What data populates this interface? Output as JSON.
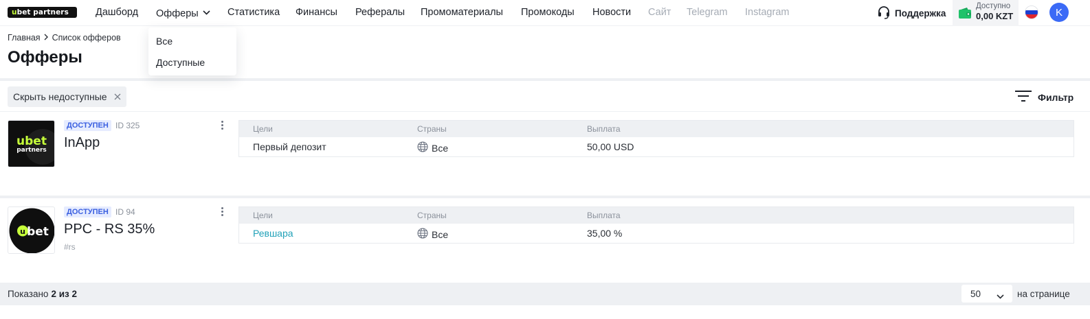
{
  "brand": {
    "logo_u": "u",
    "logo_rest": "bet partners"
  },
  "nav": {
    "items": [
      "Дашборд",
      "Офферы",
      "Статистика",
      "Финансы",
      "Рефералы",
      "Промоматериалы",
      "Промокоды",
      "Новости",
      "Сайт",
      "Telegram",
      "Instagram"
    ],
    "support_label": "Поддержка"
  },
  "wallet": {
    "label": "Доступно",
    "amount": "0,00 KZT"
  },
  "user": {
    "avatar_initial": "K"
  },
  "offers_menu": {
    "items": [
      "Все",
      "Доступные"
    ]
  },
  "breadcrumb": {
    "home": "Главная",
    "current": "Список офферов"
  },
  "page": {
    "title": "Офферы"
  },
  "filters": {
    "chip_label": "Скрыть недоступные",
    "filter_button_label": "Фильтр"
  },
  "table_headers": {
    "goals": "Цели",
    "countries": "Страны",
    "payout": "Выплата"
  },
  "offers": [
    {
      "status": "ДОСТУПЕН",
      "id_label": "ID 325",
      "name": "InApp",
      "tag": "",
      "logo_text_top": "ubet",
      "logo_text_bottom": "partners",
      "goal": "Первый депозит",
      "country": "Все",
      "payout": "50,00 USD"
    },
    {
      "status": "ДОСТУПЕН",
      "id_label": "ID 94",
      "name": "PPC - RS 35%",
      "tag": "#rs",
      "logo_text_top": "bet",
      "goal": "Ревшара",
      "country": "Все",
      "payout": "35,00 %"
    }
  ],
  "pagination": {
    "shown_label": "Показано",
    "shown_value": "2 из 2",
    "per_page_value": "50",
    "per_page_label": "на странице"
  },
  "colors": {
    "accent": "#3b6af6",
    "link": "#21a1b8",
    "badge_bg": "#e6ecff",
    "badge_text": "#3a5fe0",
    "brand_green": "#c6ff3a",
    "wallet_green": "#21c26a"
  }
}
